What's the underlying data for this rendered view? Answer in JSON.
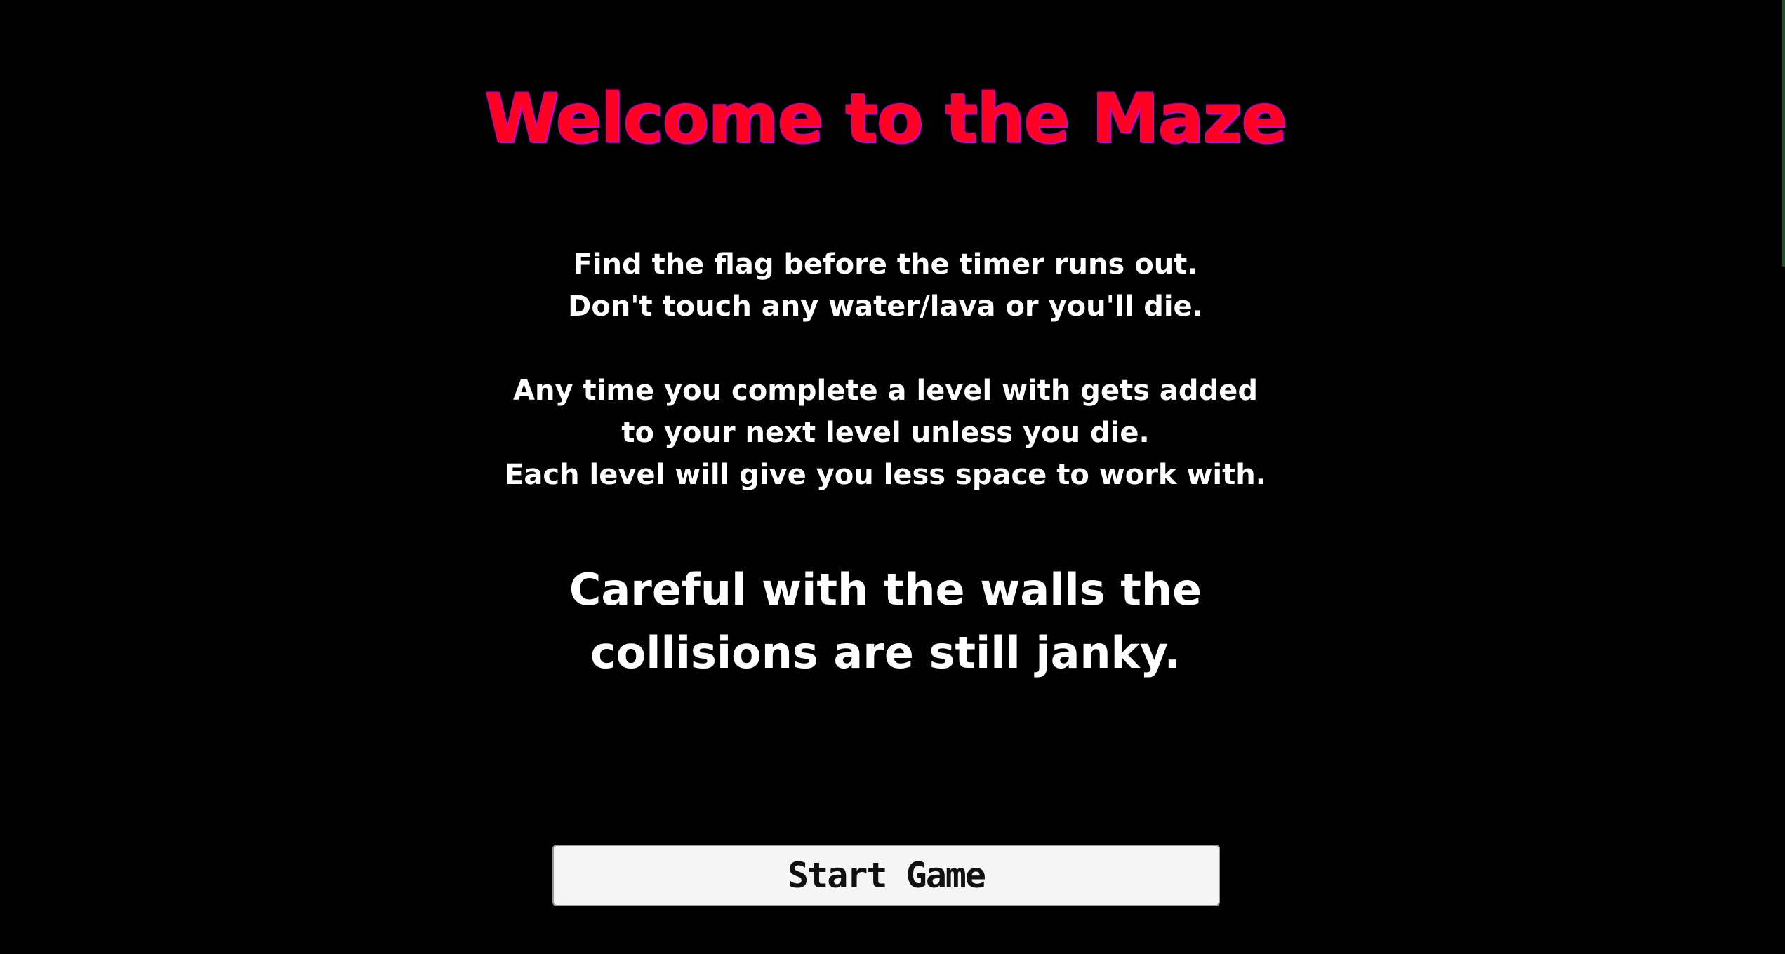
{
  "screen": {
    "title": "Welcome to the Maze",
    "instructions": {
      "line1": "Find the flag before the timer runs out.",
      "line2": "Don't touch any water/lava or you'll die.",
      "line3": "Any time you complete a level with gets added",
      "line4": "to your next level unless you die.",
      "line5": "Each level will give you less space to work with."
    },
    "warning": {
      "line1": "Careful with the walls the",
      "line2": "collisions are still janky."
    },
    "start_button_label": "Start Game"
  },
  "colors": {
    "background": "#000000",
    "title_fill": "#ff0022",
    "title_outline": "#d200d6",
    "text": "#ffffff",
    "button_background": "#f5f5f5"
  }
}
